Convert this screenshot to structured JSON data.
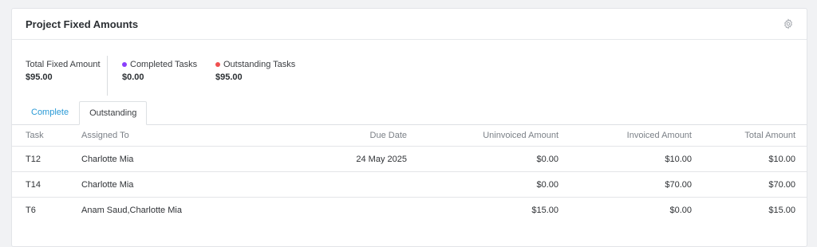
{
  "card": {
    "title": "Project Fixed Amounts",
    "settings_icon": "gear-icon"
  },
  "summary": {
    "total": {
      "label": "Total Fixed Amount",
      "value": "$95.00"
    },
    "completed": {
      "label": "Completed Tasks",
      "value": "$0.00",
      "dot_color": "#8a3ffc"
    },
    "outstanding": {
      "label": "Outstanding Tasks",
      "value": "$95.00",
      "dot_color": "#f05050"
    }
  },
  "tabs": [
    {
      "label": "Complete",
      "active": false
    },
    {
      "label": "Outstanding",
      "active": true
    }
  ],
  "table": {
    "headers": [
      "Task",
      "Assigned To",
      "Due Date",
      "Uninvoiced Amount",
      "Invoiced Amount",
      "Total Amount"
    ],
    "rows": [
      [
        "T12",
        "Charlotte Mia",
        "24 May 2025",
        "$0.00",
        "$10.00",
        "$10.00"
      ],
      [
        "T14",
        "Charlotte Mia",
        "",
        "$0.00",
        "$70.00",
        "$70.00"
      ],
      [
        "T6",
        "Anam Saud,Charlotte Mia",
        "",
        "$15.00",
        "$0.00",
        "$15.00"
      ]
    ]
  },
  "colors": {
    "link": "#2a9ad6",
    "background": "#f1f2f4"
  }
}
